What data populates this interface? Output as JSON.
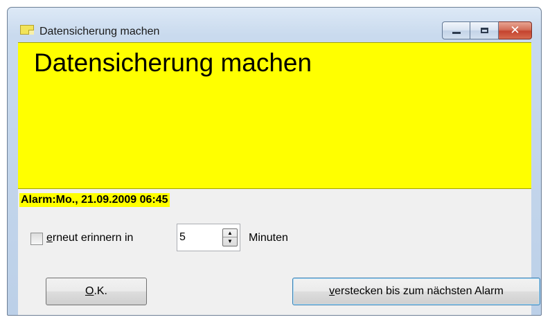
{
  "window": {
    "title": "Datensicherung machen"
  },
  "title_controls": {
    "minimize": "minimize-icon",
    "maximize": "maximize-icon",
    "close": "close-icon",
    "close_glyph": "✕"
  },
  "note": {
    "text": "Datensicherung machen",
    "background": "#ffff00"
  },
  "alarm": {
    "text": "Alarm:Mo., 21.09.2009 06:45"
  },
  "remind": {
    "checked": false,
    "label_mnemonic": "e",
    "label_rest": "rneut erinnern in",
    "minutes_value": "5",
    "minutes_label": "Minuten"
  },
  "buttons": {
    "ok_mnemonic": "O",
    "ok_rest": ".K.",
    "hide_mnemonic": "v",
    "hide_rest": "erstecken bis zum nächsten Alarm"
  }
}
